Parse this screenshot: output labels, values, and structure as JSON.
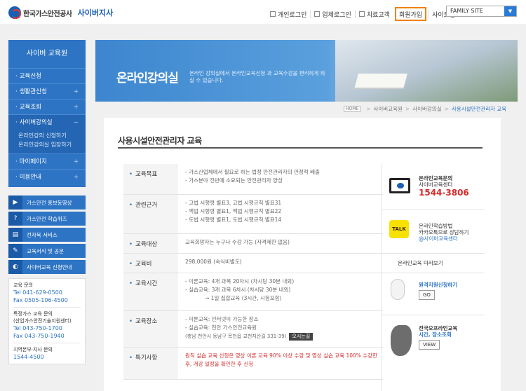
{
  "header": {
    "logo_name": "한국가스안전공사",
    "logo_sub": "사이버지사",
    "nav": [
      {
        "label": "개인로그인",
        "icon": "person-icon"
      },
      {
        "label": "업체로그인",
        "icon": "building-icon"
      },
      {
        "label": "치료고객",
        "icon": "document-icon"
      },
      {
        "label": "회원가입",
        "icon": ""
      },
      {
        "label": "사이트맵",
        "icon": ""
      }
    ],
    "family_site": "FAMILY SITE",
    "accent": "#f08000"
  },
  "sidebar": {
    "title": "사이버 교육원",
    "menu": [
      {
        "label": "교육신청"
      },
      {
        "label": "생활관신청"
      },
      {
        "label": "교육조회"
      },
      {
        "label": "사이버강의실"
      },
      {
        "label": "마이페이지"
      },
      {
        "label": "이용안내"
      }
    ],
    "sub_items": [
      "온라인강의 신청하기",
      "온라인강의실 입장하기"
    ],
    "quick_links": [
      {
        "label": "가스안전 홍보동영상",
        "icon": "video-icon"
      },
      {
        "label": "가스안전 학습퀴즈",
        "icon": "quiz-icon"
      },
      {
        "label": "전자북 서비스",
        "icon": "ebook-icon"
      },
      {
        "label": "교육서식 및 공문",
        "icon": "form-icon"
      },
      {
        "label": "사이버교육 신청안내",
        "icon": "guide-icon"
      }
    ],
    "contacts": {
      "edu_label": "교육 문의",
      "edu_tel": "Tel 041-629-0500",
      "edu_fax": "Fax 0505-106-4500",
      "special_label": "특정가스 교육 문의",
      "special_label2": "(산업가스안전기술지원센터)",
      "special_tel": "Tel 043-750-1700",
      "special_fax": "Fax 043-750-1940",
      "branch_label": "지역본부·지사 문의",
      "branch_tel": "1544-4500"
    },
    "color": "#2e74c4"
  },
  "banner": {
    "title": "온라인강의실",
    "desc": "온라인 강의실에서 온라인교육신청 과 교육수강을 편리하게 하실 수 있습니다."
  },
  "breadcrumb": [
    "HOME",
    "사이버교육원",
    "사이버강의실",
    "사용시설안전관리자 교육"
  ],
  "content": {
    "title": "사용시설안전관리자 교육",
    "rows": [
      {
        "label": "교육목표",
        "lines": [
          "- 가스산업체에서 필요로 하는 법정 안전관리자의 안정적 배출",
          "- 가스분야 전반에 소요되는 안전관리자 양성"
        ]
      },
      {
        "label": "관련근거",
        "lines": [
          "- 고법 시행령 별표3, 고법 시행규칙 별표31",
          "- 액법 시행령 별표1, 액법 시행규칙 별표22",
          "- 도법 시행령 별표1, 도법 시행규칙 별표14"
        ]
      },
      {
        "label": "교육대상",
        "lines": [
          "교육희망자는 누구나 수강 가능 (자격제한 없음)"
        ]
      },
      {
        "label": "교육비",
        "lines": [
          "298,000원 (숙식비별도)"
        ]
      },
      {
        "label": "교육시간",
        "lines": [
          "- 이론교육: 4개 과목 20차시 (차시당 30분 내외)",
          "- 실습교육: 3개 과목 6차시 (차시당 30분 내외)",
          "→ 1일 집합교육 (3시간, 시험포함)"
        ]
      },
      {
        "label": "교육장소",
        "lines": [
          "- 이론교육: 인터넷이 가능한 장소",
          "- 실습교육: 천안 가스안전교육원",
          "(충남 천안시 동남구 목천읍 교천지산길 331-39)"
        ],
        "button": "오시는길"
      },
      {
        "label": "특기사항",
        "lines": [
          "원칙 실습 교육 신청은 영상 이론 교육 90% 이상 수강 및 영상 실습 교육 100% 수강한 후, 개강 일정을 확인한 후 신청"
        ]
      }
    ],
    "right": {
      "online_label1": "온라인교육문의",
      "online_label2": "사이버교육센터",
      "online_tel": "1544-3806",
      "talk_badge": "TALK",
      "talk_label1": "온라인학습방법",
      "talk_label2": "카카오톡으로 상담하기",
      "talk_handle": "@사이버교육센터",
      "preview_alt": "온라인교육 미리보기",
      "remote_label": "원격지원신청하기",
      "remote_btn": "GO",
      "nation_label1": "전국오프라인교육",
      "nation_label2": "시간, 장소조회",
      "nation_btn": "VIEW"
    }
  }
}
